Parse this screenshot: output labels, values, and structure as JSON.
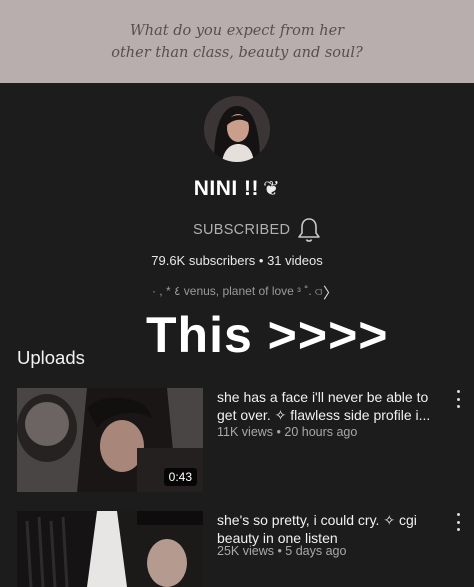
{
  "banner": {
    "line1": "What do you expect from her",
    "line2": "other than class, beauty and soul?"
  },
  "channel": {
    "name": "NINI !!",
    "name_emoji": "❦",
    "subscribe_state": "SUBSCRIBED",
    "stats": "79.6K subscribers • 31 videos",
    "bio": "· , * ٤ venus, planet of love ᶟ ˚. ⫏"
  },
  "overlay": {
    "text": "This >>>>"
  },
  "uploads": {
    "heading": "Uploads",
    "videos": [
      {
        "title": "she has a face i'll never be able to get over. ✧ flawless side profile i...",
        "meta": "11K views • 20 hours ago",
        "duration": "0:43"
      },
      {
        "title": "she's so pretty, i could cry. ✧ cgi beauty in one listen",
        "meta": "25K views • 5 days ago",
        "duration": ""
      }
    ]
  },
  "icons": {
    "bell": "bell-icon",
    "chevron": "chevron-right-icon",
    "more": "more-vert-icon"
  },
  "colors": {
    "background": "#1c1c1c",
    "banner": "#b9aeae",
    "banner_text": "#5a4d4d",
    "secondary_text": "#a8a8a8"
  }
}
